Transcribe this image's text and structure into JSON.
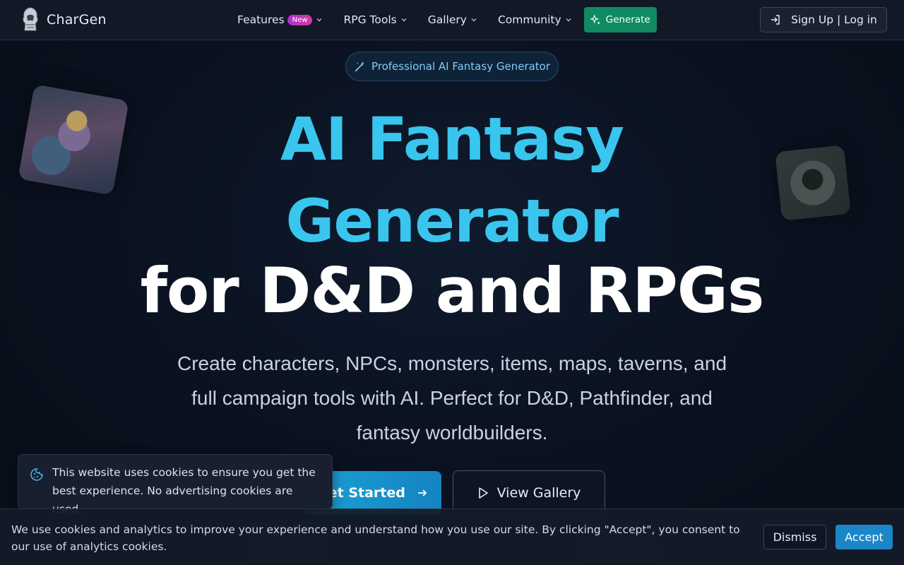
{
  "brand": {
    "name": "CharGen"
  },
  "nav": {
    "items": [
      {
        "label": "Features",
        "badge": "New"
      },
      {
        "label": "RPG Tools"
      },
      {
        "label": "Gallery"
      },
      {
        "label": "Community"
      }
    ],
    "generate_label": "Generate",
    "auth_label": "Sign Up | Log in"
  },
  "hero": {
    "pill": "Professional AI Fantasy Generator",
    "title_line1": "AI Fantasy",
    "title_line2": "Generator",
    "title_line3": "for D&D and RPGs",
    "subtitle": "Create characters, NPCs, monsters, items, maps, taverns, and full campaign tools with AI. Perfect for D&D, Pathfinder, and fantasy worldbuilders.",
    "cta_primary": "Get Started",
    "cta_secondary": "View Gallery"
  },
  "toast": {
    "text": "This website uses cookies to ensure you get the best experience. No advertising cookies are used."
  },
  "cookie_bar": {
    "text": "We use cookies and analytics to improve your experience and understand how you use our site. By clicking \"Accept\", you consent to our use of analytics cookies.",
    "dismiss_label": "Dismiss",
    "accept_label": "Accept"
  },
  "colors": {
    "accent": "#39c5ee",
    "generate": "#0f8a62",
    "accept": "#1b86c8",
    "badge": "#c234c0"
  }
}
